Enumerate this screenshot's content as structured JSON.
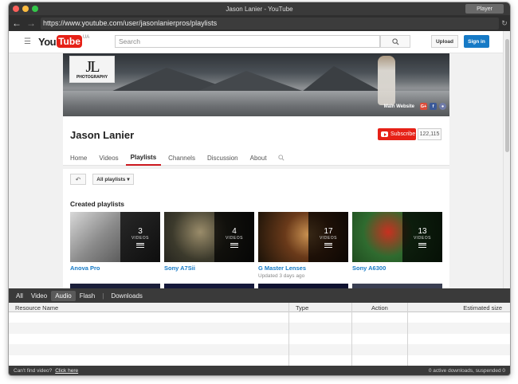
{
  "window": {
    "title": "Jason Lanier - YouTube",
    "player_button": "Player",
    "url": "https://www.youtube.com/user/jasonlanierpros/playlists"
  },
  "youtube": {
    "logo_you": "You",
    "logo_tube": "Tube",
    "country": "UA",
    "search_placeholder": "Search",
    "upload_label": "Upload",
    "signin_label": "Sign in"
  },
  "banner": {
    "logo_text": "PHOTOGRAPHY",
    "main_website": "Main Website",
    "social": [
      "G+",
      "f",
      "●"
    ]
  },
  "channel": {
    "name": "Jason Lanier",
    "subscribe_label": "Subscribe",
    "subscriber_count": "122,115",
    "tabs": [
      "Home",
      "Videos",
      "Playlists",
      "Channels",
      "Discussion",
      "About"
    ],
    "active_tab": "Playlists"
  },
  "content": {
    "filter_label": "All playlists",
    "section_title": "Created playlists",
    "playlists": [
      {
        "title": "Anova Pro",
        "count": "3",
        "videos_label": "VIDEOS",
        "meta": "",
        "thumb_color": "#7a7a7a"
      },
      {
        "title": "Sony A7Sii",
        "count": "4",
        "videos_label": "VIDEOS",
        "meta": "",
        "thumb_color": "#4b5a5a"
      },
      {
        "title": "G Master Lenses",
        "count": "17",
        "videos_label": "VIDEOS",
        "meta": "Updated 3 days ago",
        "thumb_color": "#6b4a22"
      },
      {
        "title": "Sony A6300",
        "count": "13",
        "videos_label": "VIDEOS",
        "meta": "",
        "thumb_color": "#2f6b2f"
      }
    ]
  },
  "downloads": {
    "tabs": [
      "All",
      "Video",
      "Audio",
      "Flash"
    ],
    "active_tab": "Audio",
    "downloads_label": "Downloads",
    "columns": [
      "Resource Name",
      "Type",
      "Action",
      "Estimated size"
    ],
    "cant_find": "Can't find video?",
    "click_here": "Click here",
    "status": "0 active downloads, suspended 0"
  },
  "colors": {
    "youtube_red": "#e62117",
    "link_blue": "#167ac6",
    "signin_blue": "#167ac6"
  }
}
